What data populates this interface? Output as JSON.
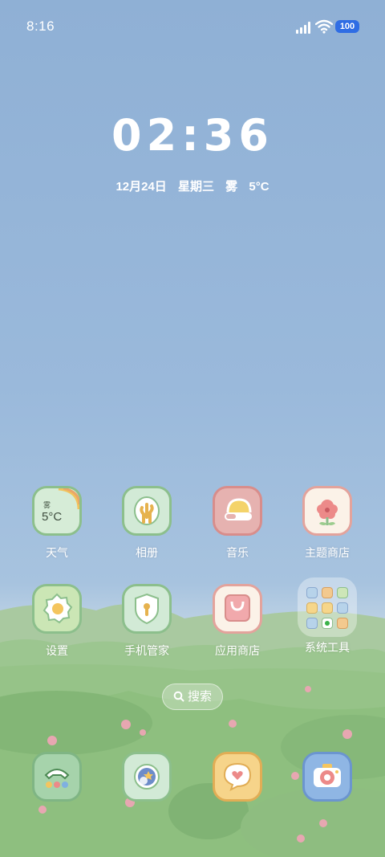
{
  "status": {
    "time": "8:16",
    "battery": "100"
  },
  "lock": {
    "clock": "02:36",
    "date": "12月24日",
    "weekday": "星期三",
    "weather": "雾",
    "temp": "5°C"
  },
  "weather_widget": {
    "condition": "雾",
    "temp": "5°C"
  },
  "apps_row1": [
    {
      "label": "天气",
      "icon": "weather-icon"
    },
    {
      "label": "相册",
      "icon": "gallery-icon"
    },
    {
      "label": "音乐",
      "icon": "music-icon"
    },
    {
      "label": "主题商店",
      "icon": "theme-store-icon"
    }
  ],
  "apps_row2": [
    {
      "label": "设置",
      "icon": "settings-icon"
    },
    {
      "label": "手机管家",
      "icon": "phone-manager-icon"
    },
    {
      "label": "应用商店",
      "icon": "app-store-icon"
    },
    {
      "label": "系统工具",
      "icon": "system-tools-folder"
    }
  ],
  "search": {
    "label": "搜索"
  },
  "dock": [
    {
      "icon": "phone-icon"
    },
    {
      "icon": "browser-icon"
    },
    {
      "icon": "messages-icon"
    },
    {
      "icon": "camera-icon"
    }
  ],
  "colors": {
    "sky": "#9ab9db",
    "grass": "#8cc07c",
    "battery": "#2f6de4"
  }
}
